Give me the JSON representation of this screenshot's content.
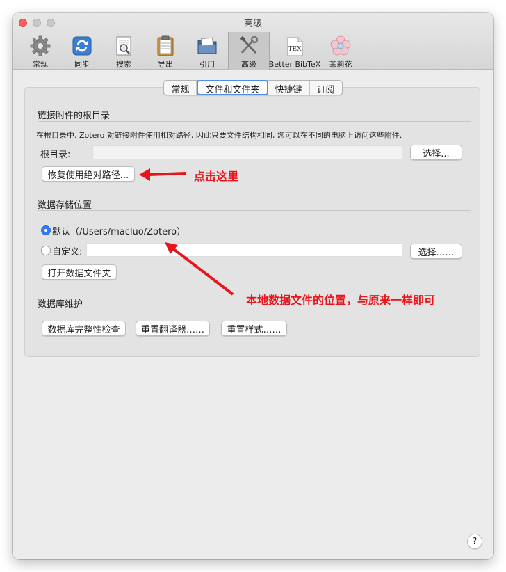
{
  "window": {
    "title": "高级"
  },
  "toolbar": [
    {
      "label": "常规",
      "icon": "gear-icon"
    },
    {
      "label": "同步",
      "icon": "sync-icon"
    },
    {
      "label": "搜索",
      "icon": "search-icon"
    },
    {
      "label": "导出",
      "icon": "clipboard-icon"
    },
    {
      "label": "引用",
      "icon": "folder-icon"
    },
    {
      "label": "高级",
      "icon": "tools-icon"
    },
    {
      "label": "Better BibTeX",
      "icon": "tex-icon",
      "icon_text": "TEX"
    },
    {
      "label": "茉莉花",
      "icon": "flower-icon"
    }
  ],
  "tabs": [
    "常规",
    "文件和文件夹",
    "快捷键",
    "订阅"
  ],
  "selected_tab": "文件和文件夹",
  "linked_attachments": {
    "title": "链接附件的根目录",
    "description": "在根目录中, Zotero 对链接附件使用相对路径, 因此只要文件结构相同, 您可以在不同的电脑上访问这些附件.",
    "base_dir_label": "根目录:",
    "base_dir_value": "",
    "choose_button": "选择...",
    "revert_button": "恢复使用绝对路径..."
  },
  "data_location": {
    "title": "数据存储位置",
    "default_label": "默认（/Users/macluo/Zotero）",
    "custom_label": "自定义:",
    "custom_value": "",
    "choose_button": "选择……",
    "open_button": "打开数据文件夹",
    "selected": "default"
  },
  "database": {
    "title": "数据库维护",
    "integrity_button": "数据库完整性检查",
    "reset_translators_button": "重置翻译器……",
    "reset_styles_button": "重置样式……"
  },
  "annotations": {
    "click_here": "点击这里",
    "location_note": "本地数据文件的位置，与原来一样即可"
  },
  "help": "?",
  "colors": {
    "accent": "#2f7bf5",
    "annotation_red": "#e8141a"
  }
}
